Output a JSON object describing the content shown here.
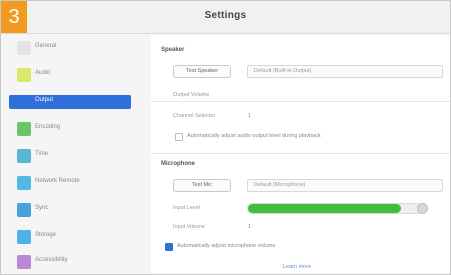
{
  "window": {
    "title": "Settings",
    "step_badge": "3"
  },
  "sidebar": {
    "items": [
      {
        "label": "General",
        "icon": "gear-icon",
        "color": "#e3e3e3",
        "active": false
      },
      {
        "label": "Audio",
        "icon": "audio-icon",
        "color": "#d9e86b",
        "active": false
      },
      {
        "label": "Output",
        "icon": "output-icon",
        "color": "#2f6fd8",
        "active": true
      },
      {
        "label": "Encoding",
        "icon": "encoding-icon",
        "color": "#6cc46c",
        "active": false
      },
      {
        "label": "Time",
        "icon": "clock-icon",
        "color": "#59b7d6",
        "active": false
      },
      {
        "label": "Network Remote",
        "icon": "network-icon",
        "color": "#4fbbe0",
        "active": false
      },
      {
        "label": "Sync",
        "icon": "sync-icon",
        "color": "#4aa0dd",
        "active": false
      },
      {
        "label": "Storage",
        "icon": "storage-icon",
        "color": "#4fb2e6",
        "active": false
      },
      {
        "label": "Accessibility",
        "icon": "accessibility-icon",
        "color": "#b688d6",
        "active": false
      }
    ]
  },
  "content": {
    "speaker_section": {
      "title": "Speaker",
      "button_label": "Test Speaker",
      "device_value": "Default (Built-in Output)",
      "volume_label": "Output Volume",
      "channel_label": "Channel Selector",
      "channel_value": "1",
      "checkbox_label": "Automatically adjust audio output level during playback",
      "checkbox_checked": false
    },
    "mic_section": {
      "title": "Microphone",
      "button_label": "Test Mic",
      "device_value": "Default (Microphone)",
      "input_level_label": "Input Level",
      "input_level_percent": 88,
      "input_level_color": "#3fbf3f",
      "volume_label": "Input Volume",
      "volume_value": "1",
      "auto_adjust_label": "Automatically adjust microphone volume",
      "auto_adjust_checked": true,
      "link_text": "Learn more"
    }
  }
}
